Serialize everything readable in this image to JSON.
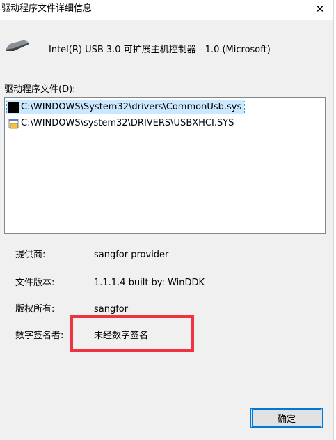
{
  "window": {
    "title": "驱动程序文件详细信息",
    "close_glyph": "✕"
  },
  "device": {
    "icon": "usb-plug-icon",
    "name": "Intel(R) USB 3.0 可扩展主机控制器 - 1.0 (Microsoft)"
  },
  "files": {
    "label_prefix": "驱动程序文件(",
    "label_accel": "D",
    "label_suffix": "):",
    "items": [
      {
        "path": "C:\\WINDOWS\\System32\\drivers\\CommonUsb.sys",
        "icon": "black-file-icon",
        "selected": true
      },
      {
        "path": "C:\\WINDOWS\\system32\\DRIVERS\\USBXHCI.SYS",
        "icon": "system-file-icon",
        "selected": false
      }
    ]
  },
  "info": {
    "provider_label": "提供商:",
    "provider_value": "sangfor provider",
    "version_label": "文件版本:",
    "version_value": "1.1.1.4 built by: WinDDK",
    "copyright_label": "版权所有:",
    "copyright_value": "sangfor",
    "signer_label": "数字签名者:",
    "signer_value": "未经数字签名"
  },
  "highlight_color": "#ef3340",
  "ok_label": "确定"
}
